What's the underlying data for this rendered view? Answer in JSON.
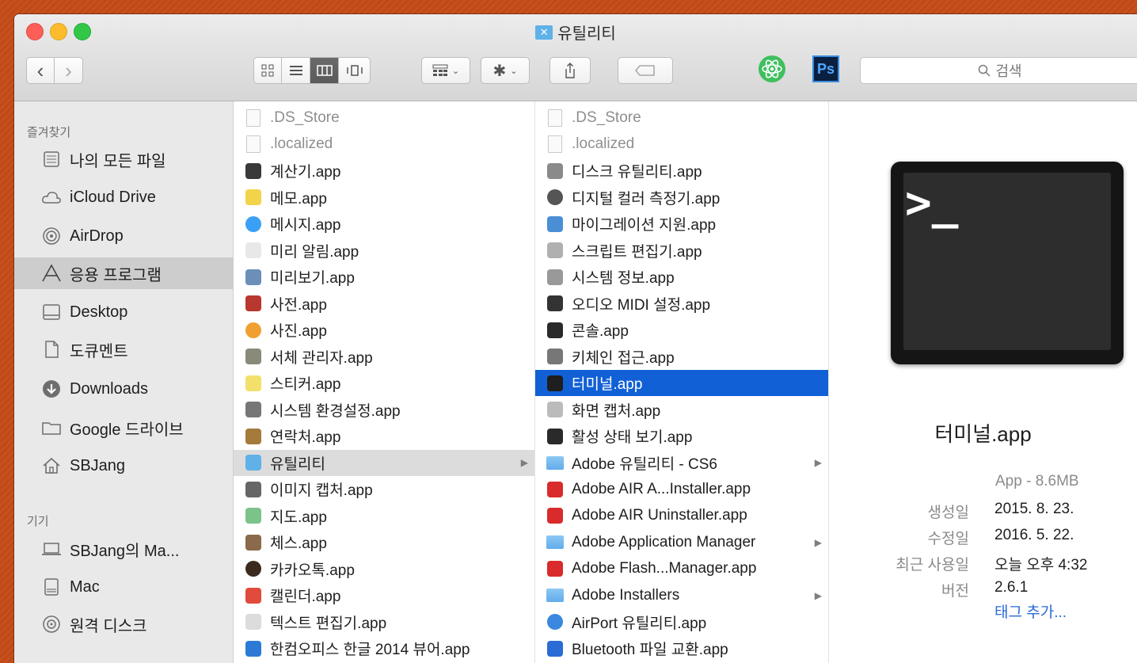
{
  "window": {
    "title": "유틸리티",
    "search_placeholder": "검색"
  },
  "toolbar": {
    "back": "‹",
    "forward": "›",
    "view_icon": "icon-view",
    "view_list": "list-view",
    "view_column": "column-view",
    "view_coverflow": "coverflow-view",
    "arrange": "arrange",
    "action": "action",
    "share": "share",
    "tags": "tags",
    "app_atom": "atom-icon",
    "app_ps": "Ps"
  },
  "sidebar": {
    "favorites_header": "즐겨찾기",
    "favorites": [
      {
        "label": "나의 모든 파일",
        "icon": "all-files-icon"
      },
      {
        "label": "iCloud Drive",
        "icon": "cloud-icon"
      },
      {
        "label": "AirDrop",
        "icon": "airdrop-icon"
      },
      {
        "label": "응용 프로그램",
        "icon": "applications-icon"
      },
      {
        "label": "Desktop",
        "icon": "desktop-icon"
      },
      {
        "label": "도큐멘트",
        "icon": "document-icon"
      },
      {
        "label": "Downloads",
        "icon": "download-icon"
      },
      {
        "label": "Google 드라이브",
        "icon": "folder-icon"
      },
      {
        "label": "SBJang",
        "icon": "home-icon"
      }
    ],
    "devices_header": "기기",
    "devices": [
      {
        "label": "SBJang의 Ma...",
        "icon": "laptop-icon"
      },
      {
        "label": "Mac",
        "icon": "disk-icon"
      },
      {
        "label": "원격 디스크",
        "icon": "remote-disc-icon"
      }
    ]
  },
  "column1": [
    {
      "label": ".DS_Store",
      "icon": "doc",
      "dim": true
    },
    {
      "label": ".localized",
      "icon": "doc",
      "dim": true
    },
    {
      "label": "계산기.app",
      "icon": "calculator"
    },
    {
      "label": "메모.app",
      "icon": "notes"
    },
    {
      "label": "메시지.app",
      "icon": "messages"
    },
    {
      "label": "미리 알림.app",
      "icon": "reminders"
    },
    {
      "label": "미리보기.app",
      "icon": "preview"
    },
    {
      "label": "사전.app",
      "icon": "dictionary"
    },
    {
      "label": "사진.app",
      "icon": "photos"
    },
    {
      "label": "서체 관리자.app",
      "icon": "fontbook"
    },
    {
      "label": "스티커.app",
      "icon": "stickies"
    },
    {
      "label": "시스템 환경설정.app",
      "icon": "preferences"
    },
    {
      "label": "연락처.app",
      "icon": "contacts"
    },
    {
      "label": "유틸리티",
      "icon": "utilities-folder",
      "selected": true,
      "folder": true
    },
    {
      "label": "이미지 캡처.app",
      "icon": "image-capture"
    },
    {
      "label": "지도.app",
      "icon": "maps"
    },
    {
      "label": "체스.app",
      "icon": "chess"
    },
    {
      "label": "카카오톡.app",
      "icon": "kakaotalk"
    },
    {
      "label": "캘린더.app",
      "icon": "calendar"
    },
    {
      "label": "텍스트 편집기.app",
      "icon": "textedit"
    },
    {
      "label": "한컴오피스 한글 2014 뷰어.app",
      "icon": "hancom"
    }
  ],
  "column2": [
    {
      "label": ".DS_Store",
      "icon": "doc",
      "dim": true
    },
    {
      "label": ".localized",
      "icon": "doc",
      "dim": true
    },
    {
      "label": "디스크 유틸리티.app",
      "icon": "disk-utility"
    },
    {
      "label": "디지털 컬러 측정기.app",
      "icon": "color-meter"
    },
    {
      "label": "마이그레이션 지원.app",
      "icon": "migration"
    },
    {
      "label": "스크립트 편집기.app",
      "icon": "script-editor"
    },
    {
      "label": "시스템 정보.app",
      "icon": "system-info"
    },
    {
      "label": "오디오 MIDI 설정.app",
      "icon": "audio-midi"
    },
    {
      "label": "콘솔.app",
      "icon": "console"
    },
    {
      "label": "키체인 접근.app",
      "icon": "keychain"
    },
    {
      "label": "터미널.app",
      "icon": "terminal",
      "selected": true
    },
    {
      "label": "화면 캡처.app",
      "icon": "grab"
    },
    {
      "label": "활성 상태 보기.app",
      "icon": "activity-monitor"
    },
    {
      "label": "Adobe 유틸리티 - CS6",
      "icon": "folder",
      "folder": true
    },
    {
      "label": "Adobe AIR A...Installer.app",
      "icon": "adobe-air"
    },
    {
      "label": "Adobe AIR Uninstaller.app",
      "icon": "adobe-air"
    },
    {
      "label": "Adobe Application Manager",
      "icon": "folder",
      "folder": true
    },
    {
      "label": "Adobe Flash...Manager.app",
      "icon": "adobe-flash"
    },
    {
      "label": "Adobe Installers",
      "icon": "folder",
      "folder": true
    },
    {
      "label": "AirPort 유틸리티.app",
      "icon": "airport"
    },
    {
      "label": "Bluetooth 파일 교환.app",
      "icon": "bluetooth"
    }
  ],
  "preview": {
    "prompt": ">_",
    "name": "터미널.app",
    "kind": "App - 8.6MB",
    "rows": [
      {
        "label": "생성일",
        "value": "2015. 8. 23."
      },
      {
        "label": "수정일",
        "value": "2016. 5. 22."
      },
      {
        "label": "최근 사용일",
        "value": "오늘 오후 4:32"
      },
      {
        "label": "버전",
        "value": "2.6.1"
      }
    ],
    "add_tag": "태그 추가..."
  }
}
